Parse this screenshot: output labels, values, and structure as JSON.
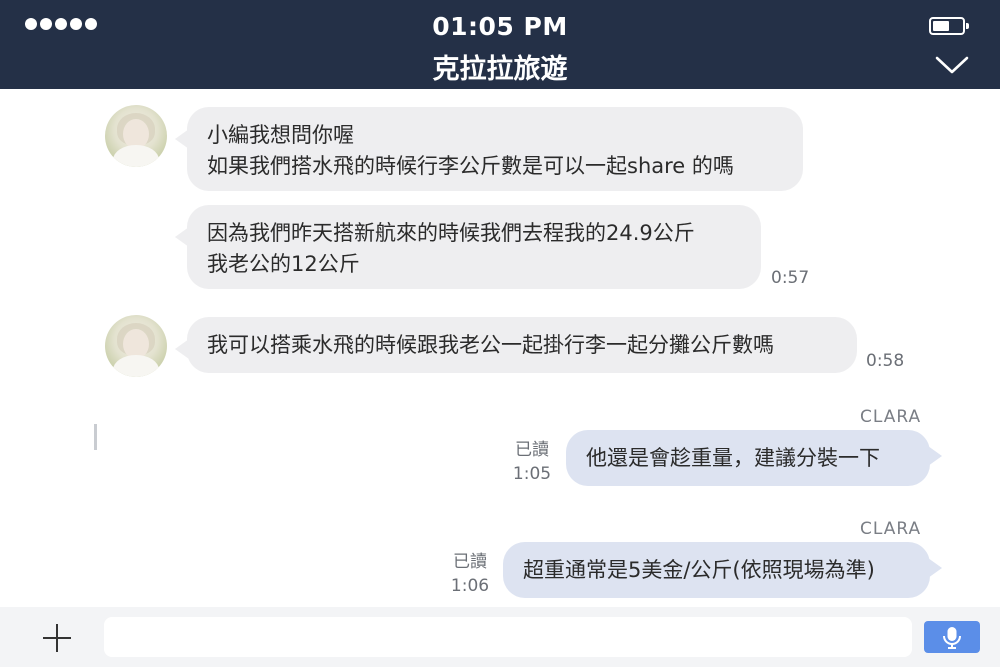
{
  "status_bar": {
    "time": "01:05 PM",
    "signal_icon": "signal-dots-icon",
    "battery_icon": "battery-icon"
  },
  "header": {
    "title": "克拉拉旅遊",
    "collapse_icon": "chevron-down-icon",
    "background": "#243047"
  },
  "messages": [
    {
      "direction": "incoming",
      "lines": [
        "小編我想問你喔",
        "如果我們搭水飛的時候行李公斤數是可以一起share 的嗎"
      ],
      "time": ""
    },
    {
      "direction": "incoming",
      "lines": [
        "因為我們昨天搭新航來的時候我們去程我的24.9公斤",
        "我老公的12公斤"
      ],
      "time": "0:57"
    },
    {
      "direction": "incoming",
      "lines": [
        "我可以搭乘水飛的時候跟我老公一起掛行李一起分攤公斤數嗎"
      ],
      "time": "0:58"
    },
    {
      "direction": "outgoing",
      "sender": "CLARA",
      "lines": [
        "他還是會趁重量，建議分裝一下"
      ],
      "read_label": "已讀",
      "time": "1:05"
    },
    {
      "direction": "outgoing",
      "sender": "CLARA",
      "lines": [
        "超重通常是5美金/公斤(依照現場為準)"
      ],
      "read_label": "已讀",
      "time": "1:06"
    }
  ],
  "input_bar": {
    "add_icon": "plus-icon",
    "message_value": "",
    "message_placeholder": "",
    "mic_icon": "microphone-icon",
    "accent": "#5b8ee8"
  },
  "colors": {
    "incoming_bubble": "#eeeef0",
    "outgoing_bubble": "#dde3f1"
  }
}
